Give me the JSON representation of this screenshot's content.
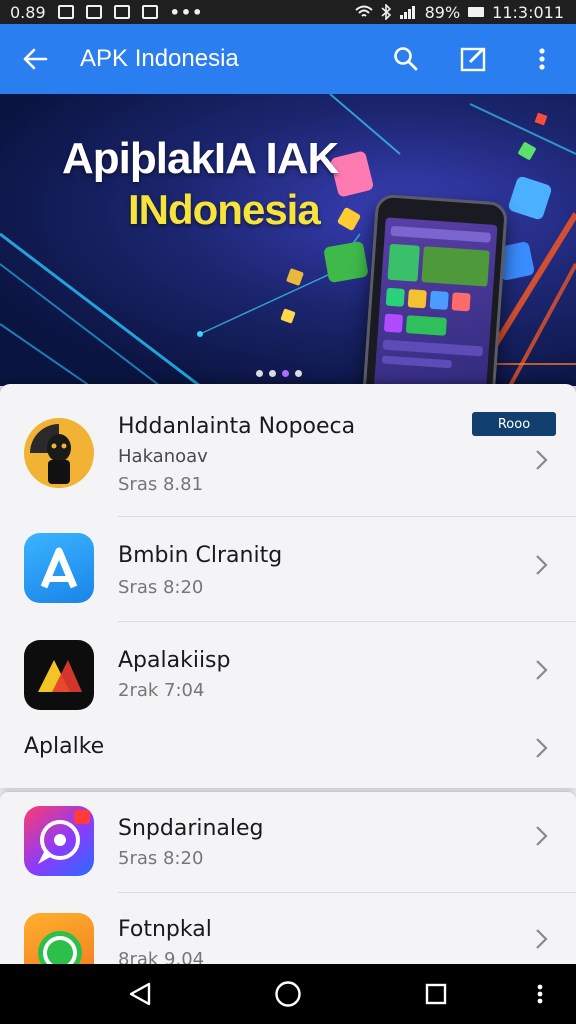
{
  "status_bar": {
    "time_left": "0.89",
    "battery": "89%",
    "clock": "11:3:011",
    "icons": [
      "notification-icon",
      "image-icon",
      "cast-icon",
      "sync-icon",
      "more-dots-icon",
      "wifi-icon",
      "bluetooth-icon",
      "signal-icon",
      "battery-icon"
    ],
    "more_dots": "•••"
  },
  "app_bar": {
    "title": "APK Indonesia",
    "color": "#2b7ef0",
    "icons": [
      "back-arrow-icon",
      "search-icon",
      "edit-icon",
      "more-vert-icon"
    ]
  },
  "banner": {
    "title_line1": "ApiþlakIA IAK",
    "title_line2": "INdonesia",
    "title2_color": "#f6e33b",
    "page_indicator": {
      "count": 4,
      "active": 3
    }
  },
  "list": {
    "items": [
      {
        "name": "Hddanlainta Nopoeca",
        "subtitle": "Hakanoav",
        "meta": "Sras 8.81",
        "badge": "Rooo",
        "icon": "hacker-avatar-icon"
      },
      {
        "name": "Bmbin Clranitg",
        "subtitle": "",
        "meta": "Sras 8:20",
        "icon": "a-logo-icon"
      },
      {
        "name": "Apalakiisp",
        "subtitle": "",
        "meta": "2rak 7:04",
        "icon": "triangle-logo-icon"
      }
    ],
    "section_label": "Aplalke",
    "items2": [
      {
        "name": "Snpdarinaleg",
        "meta": "5ras 8:20",
        "icon": "chat-bubble-icon"
      },
      {
        "name": "Fotnpkal",
        "meta": "8rak 9.04",
        "icon": "whatsapp-like-icon"
      }
    ]
  },
  "nav_bar": {
    "icons": [
      "back-triangle-icon",
      "home-circle-icon",
      "recents-square-icon",
      "more-vert-icon"
    ]
  }
}
